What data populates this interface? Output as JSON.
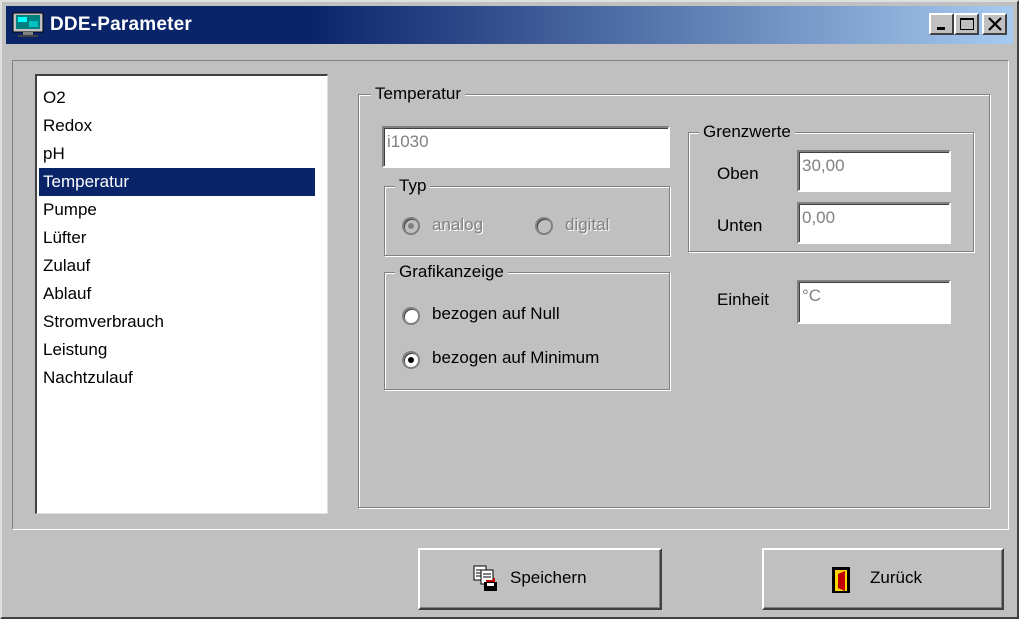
{
  "window": {
    "title": "DDE-Parameter"
  },
  "list": {
    "items": [
      "O2",
      "Redox",
      "pH",
      "Temperatur",
      "Pumpe",
      "Lüfter",
      "Zulauf",
      "Ablauf",
      "Stromverbrauch",
      "Leistung",
      "Nachtzulauf"
    ],
    "selected": "Temperatur"
  },
  "details": {
    "group_title": "Temperatur",
    "address_value": "i1030",
    "typ": {
      "title": "Typ",
      "options": [
        "analog",
        "digital"
      ],
      "selected": "analog"
    },
    "grenzwerte": {
      "title": "Grenzwerte",
      "oben_label": "Oben",
      "oben_value": "30,00",
      "unten_label": "Unten",
      "unten_value": "0,00"
    },
    "grafik": {
      "title": "Grafikanzeige",
      "options": [
        "bezogen auf Null",
        "bezogen auf Minimum"
      ],
      "selected": "bezogen auf Minimum"
    },
    "einheit_label": "Einheit",
    "einheit_value": "°C"
  },
  "buttons": {
    "save_label": "Speichern",
    "back_label": "Zurück"
  },
  "colors": {
    "titlebar_start": "#0a246a",
    "titlebar_end": "#a6caf0",
    "selection": "#0a246a",
    "face": "#c0c0c0"
  },
  "icons": {
    "title": "monitor-icon",
    "save": "save-document-icon",
    "back": "exit-door-icon"
  }
}
